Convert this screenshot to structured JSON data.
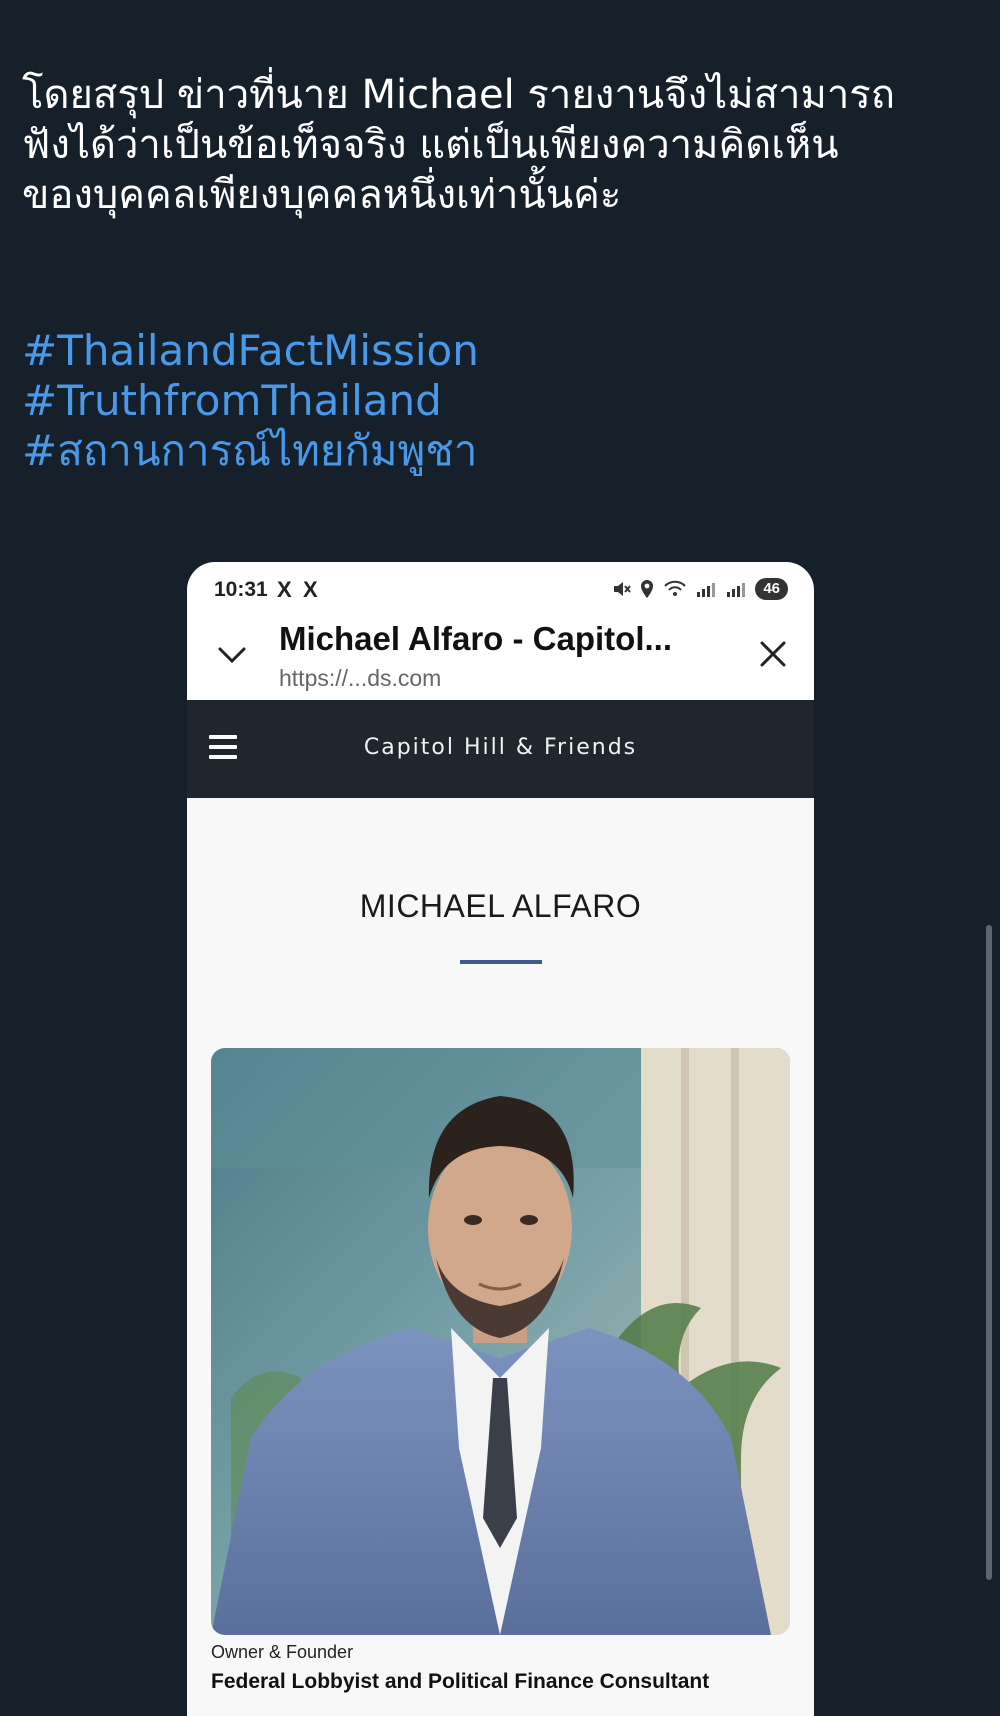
{
  "tweet": {
    "lines": [
      "โดยสรุป ข่าวที่นาย Michael รายงานจึงไม่สามารถ",
      "ฟังได้ว่าเป็นข้อเท็จจริง แต่เป็นเพียงความคิดเห็น",
      "ของบุคคลเพียงบุคคลหนึ่งเท่านั้นค่ะ"
    ],
    "hashtags": [
      "#ThailandFactMission",
      "#TruthfromThailand",
      "#สถานการณ์ไทยกัมพูชา"
    ]
  },
  "screenshot": {
    "status_bar": {
      "time": "10:31",
      "app_icons": [
        "X",
        "X"
      ],
      "battery": "46"
    },
    "browser": {
      "page_title": "Michael Alfaro - Capitol...",
      "url": "https://...ds.com"
    },
    "site": {
      "name": "Capitol Hill & Friends",
      "heading": "MICHAEL ALFARO",
      "caption_role": "Owner & Founder",
      "caption_title": "Federal Lobbyist and Political Finance Consultant"
    }
  },
  "colors": {
    "background": "#15202b",
    "hashtag": "#4a99e9",
    "site_nav": "#1f262d",
    "accent_rule": "#3f5d8c"
  }
}
